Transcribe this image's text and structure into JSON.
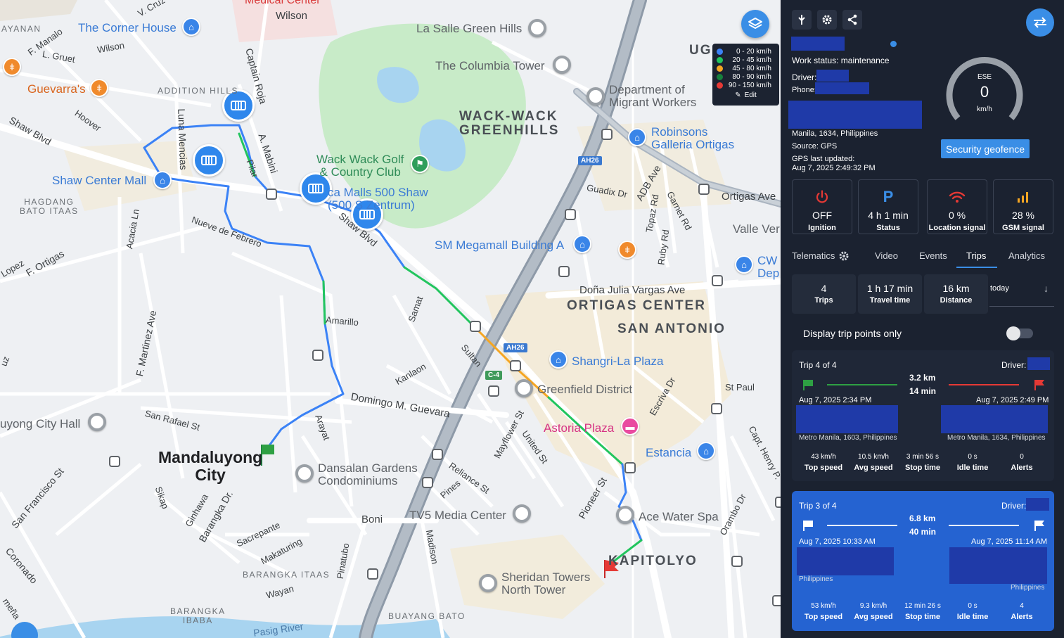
{
  "map": {
    "poi": {
      "corner_house": "The Corner House",
      "guevarras": "Guevarra's",
      "la_salle": "La Salle Green Hills",
      "columbia_tower": "The Columbia Tower",
      "dept_migrant_1": "Department of",
      "dept_migrant_2": "Migrant Workers",
      "robinsons_1": "Robinsons",
      "robinsons_2": "Galleria Ortigas",
      "wack_golf_1": "Wack Wack Golf",
      "wack_golf_2": "& Country Club",
      "shaw_center": "Shaw Center Mall",
      "sm_megamall": "SM Megamall Building A",
      "cw_1": "CW",
      "cw_2": "Dep",
      "shangri_la": "Shangri-La Plaza",
      "greenfield": "Greenfield District",
      "astoria": "Astoria Plaza",
      "estancia": "Estancia",
      "dansalan_1": "Dansalan Gardens",
      "dansalan_2": "Condominiums",
      "tv5": "TV5 Media Center",
      "ace_water": "Ace Water Spa",
      "sheridan_1": "Sheridan Towers",
      "sheridan_2": "North Tower",
      "city_hall": "uyong City Hall",
      "medical_center": "Medical Center",
      "malls_500_1": "ca Malls 500 Shaw",
      "malls_500_2": "(500 S    Zentrum)"
    },
    "areas": {
      "wack_1": "WACK-WACK",
      "wack_2": "GREENHILLS",
      "ortigas_center": "ORTIGAS CENTER",
      "san_antonio": "SAN ANTONIO",
      "kapitolyo": "KAPITOLYO",
      "ug": "UG",
      "addition_hills": "ADDITION HILLS",
      "hagdang_1": "HAGDANG",
      "hagdang_2": "BATO ITAAS",
      "barangka_itaas": "BARANGKA ITAAS",
      "barangka_ibaba_1": "BARANGKA",
      "barangka_ibaba_2": "IBABA",
      "buayang_bato": "BUAYANG BATO",
      "ayanan": "AYANAN",
      "mandaluyong_1": "Mandaluyong",
      "mandaluyong_2": "City"
    },
    "streets": {
      "wilson1": "Wilson",
      "wilson2": "Wilson",
      "f_manalo": "F. Manalo",
      "l_gruet": "L. Gruet",
      "hoover": "Hoover",
      "shaw_blvd": "Shaw Blvd",
      "shaw_blvd2": "Shaw Blvd",
      "luna_mencias": "Luna Mencias",
      "captain_roja": "Captain Roja",
      "a_mabini": "A. Mabini",
      "pilar": "Pilar",
      "nueve": "Nueve de Febrero",
      "acacia": "Acacia Ln",
      "f_ortigas": "F. Ortigas",
      "lopez": "Lopez",
      "amarillo": "Amarillo",
      "samat": "Samat",
      "sultan": "Sultan",
      "kanlaon": "Kanlaon",
      "domingo": "Domingo M. Guevara",
      "arayat": "Arayat",
      "f_martinez": "F. Martinez Ave",
      "san_rafael": "San Rafael St",
      "mayflower": "Mayflower St",
      "united": "United St",
      "reliance": "Reliance St",
      "pines": "Pines",
      "boni": "Boni",
      "madison": "Madison",
      "pinatubo": "Pinatubo",
      "pioneer": "Pioneer St",
      "guadix": "Guadix Dr",
      "adb": "ADB Ave",
      "topaz": "Topaz Rd",
      "ruby": "Ruby Rd",
      "garnet": "Garnet Rd",
      "ortigas_ave": "Ortigas Ave",
      "valle_verde": "Valle Ver",
      "dona_julia": "Doña Julia Vargas Ave",
      "escriva": "Escriva Dr",
      "st_paul": "St Paul",
      "capt_henry": "Capt. Henry P.",
      "orambo": "Orambo Dr",
      "san_francisco": "San Francisco St",
      "sikap": "Sikap",
      "ginhawa": "Ginhawa",
      "barangka_dr": "Barangka Dr.",
      "sacrepante": "Sacrepante",
      "makaturing": "Makaturing",
      "wayan": "Wayan",
      "coronado": "Coronado",
      "pasig_river": "Pasig River",
      "v_cruz": "V. Cruz",
      "meña": "meña",
      "uz": "uz",
      "ah26_1": "AH26",
      "ah26_2": "AH26",
      "c4": "C-4"
    },
    "legend": {
      "rows": [
        {
          "range": "0 -   20 km/h",
          "color": "#3b82f6"
        },
        {
          "range": "20 -   45 km/h",
          "color": "#22c55e"
        },
        {
          "range": "45 -   80 km/h",
          "color": "#f5a623"
        },
        {
          "range": "80 -   90 km/h",
          "color": "#16803c"
        },
        {
          "range": "90 - 150 km/h",
          "color": "#e53935"
        }
      ],
      "edit_label": "Edit"
    }
  },
  "vehicle": {
    "work_status": "Work status: maintenance",
    "driver_label": "Driver:",
    "phone_label": "Phone:",
    "address": "Manila, 1634, Philippines",
    "source": "Source: GPS",
    "gps_updated_label": "GPS last updated:",
    "gps_updated_value": "Aug 7, 2025 2:49:32 PM",
    "geofence_button": "Security geofence"
  },
  "gauge": {
    "direction": "ESE",
    "speed": "0",
    "unit": "km/h"
  },
  "stats": [
    {
      "value": "OFF",
      "label": "Ignition",
      "color": "#e53935"
    },
    {
      "value": "4 h 1 min",
      "label": "Status",
      "color": "#3a8ee6"
    },
    {
      "value": "0 %",
      "label": "Location signal",
      "color": "#e53935"
    },
    {
      "value": "28 %",
      "label": "GSM signal",
      "color": "#f5a623"
    }
  ],
  "tabs": {
    "telematics": "Telematics",
    "video": "Video",
    "events": "Events",
    "trips": "Trips",
    "analytics": "Analytics"
  },
  "summary": {
    "trips_value": "4",
    "trips_label": "Trips",
    "travel_value": "1 h 17 min",
    "travel_label": "Travel time",
    "distance_value": "16 km",
    "distance_label": "Distance",
    "period": "today"
  },
  "toggle_label": "Display trip points only",
  "trips": [
    {
      "title": "Trip 4 of 4",
      "driver_label": "Driver:",
      "distance": "3.2 km",
      "duration": "14 min",
      "start_time": "Aug 7, 2025 2:34 PM",
      "end_time": "Aug 7, 2025 2:49 PM",
      "start_addr": "Metro Manila, 1603, Philippines",
      "end_addr": "Metro Manila, 1634, Philippines",
      "top_speed": "43 km/h",
      "avg_speed": "10.5 km/h",
      "stop_time": "3 min 56 s",
      "idle_time": "0 s",
      "alerts": "0",
      "labels": {
        "top": "Top speed",
        "avg": "Avg speed",
        "stop": "Stop time",
        "idle": "Idle time",
        "alerts": "Alerts"
      }
    },
    {
      "title": "Trip 3 of 4",
      "driver_label": "Driver:",
      "distance": "6.8 km",
      "duration": "40 min",
      "start_time": "Aug 7, 2025 10:33 AM",
      "end_time": "Aug 7, 2025 11:14 AM",
      "start_addr": "Philippines",
      "end_addr": "Philippines",
      "top_speed": "53 km/h",
      "avg_speed": "9.3 km/h",
      "stop_time": "12 min 26 s",
      "idle_time": "0 s",
      "alerts": "4",
      "labels": {
        "top": "Top speed",
        "avg": "Avg speed",
        "stop": "Stop time",
        "idle": "Idle time",
        "alerts": "Alerts"
      }
    }
  ]
}
